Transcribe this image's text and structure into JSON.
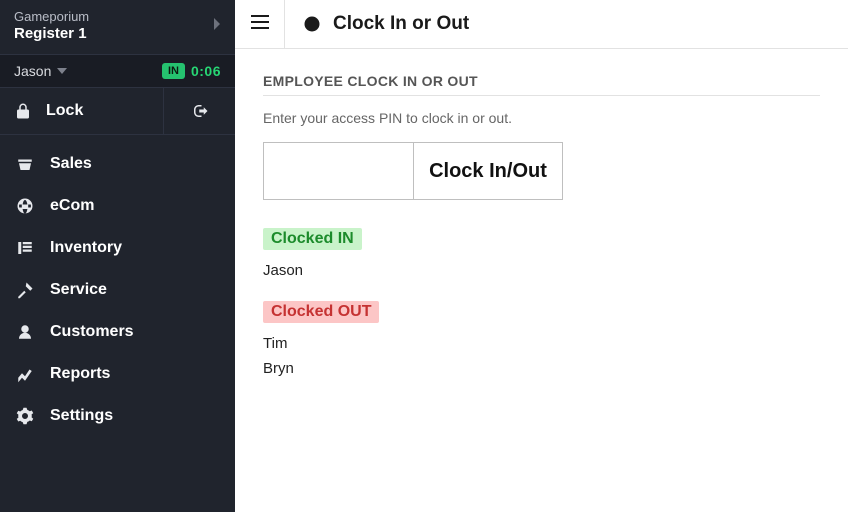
{
  "sidebar": {
    "app_name": "Gameporium",
    "register": "Register 1",
    "user": {
      "name": "Jason",
      "badge": "IN",
      "timer": "0:06"
    },
    "lock_label": "Lock",
    "items": [
      {
        "label": "Sales"
      },
      {
        "label": "eCom"
      },
      {
        "label": "Inventory"
      },
      {
        "label": "Service"
      },
      {
        "label": "Customers"
      },
      {
        "label": "Reports"
      },
      {
        "label": "Settings"
      }
    ]
  },
  "header": {
    "title": "Clock In or Out"
  },
  "panel": {
    "title": "EMPLOYEE CLOCK IN OR OUT",
    "hint": "Enter your access PIN to clock in or out.",
    "button": "Clock In/Out",
    "in_label": "Clocked IN",
    "out_label": "Clocked OUT",
    "in_names": [
      "Jason"
    ],
    "out_names": [
      "Tim",
      "Bryn"
    ]
  }
}
